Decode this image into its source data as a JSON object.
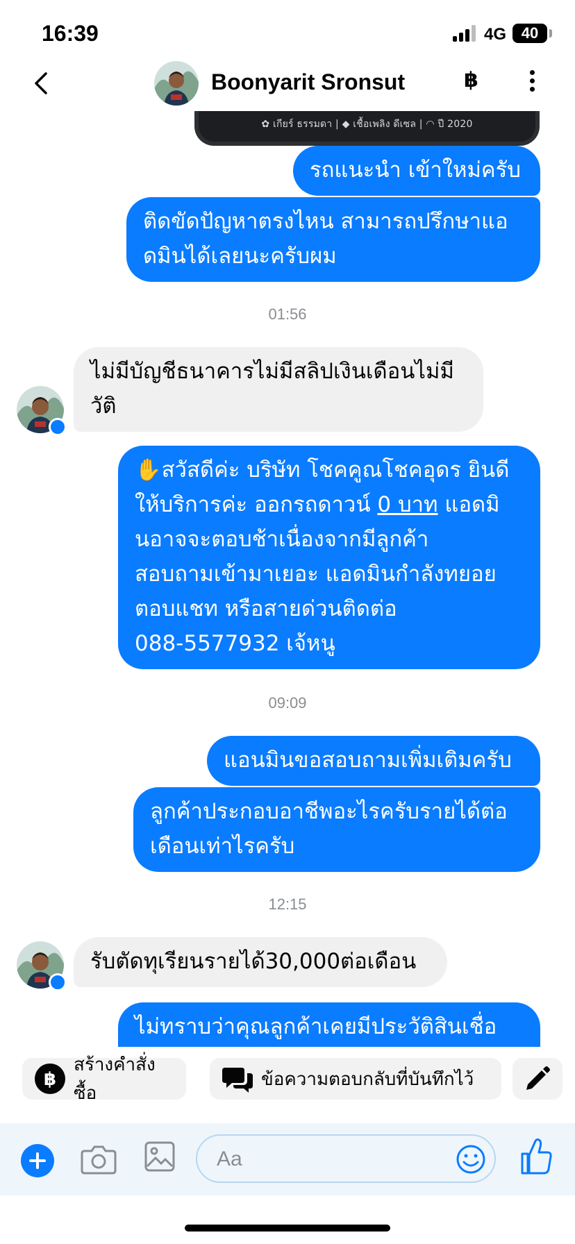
{
  "status_bar": {
    "time": "16:39",
    "network": "4G",
    "battery": "40"
  },
  "header": {
    "contact_name": "Boonyarit Sronsut",
    "baht_icon": "฿",
    "back_icon": "chevron-left-icon",
    "more_icon": "more-vertical-icon"
  },
  "card_caption": "✿ เกียร์ ธรรมดา   |  ◆ เชื้อเพลิง ดีเซล   |  ◠ ปี 2020",
  "messages": [
    {
      "from": "me",
      "text": "รถแนะนำ เข้าใหม่ครับ"
    },
    {
      "from": "me",
      "line1": "ติดขัดปัญหาตรงไหน สามารถปรึกษาแอ",
      "line2": "ดมินได้เลยนะครับผม"
    },
    {
      "timestamp": "01:56"
    },
    {
      "from": "them",
      "line1": "ไม่มีบัญชีธนาคารไม่มีสลิปเงินเดือนไม่มี",
      "line2": "วัติ"
    },
    {
      "from": "me",
      "emoji": "✋",
      "line1": "สวัสดีค่ะ บริษัท โชคคูณโชคอุดร ยินดี",
      "line2a": "ให้บริการค่ะ ออกรถดาวน์ ",
      "line2b": "0 บาท",
      "line2c": " แอดมิ",
      "line3": "นอาจจะตอบช้าเนื่องจากมีลูกค้า",
      "line4": "สอบถามเข้ามาเยอะ แอดมินกำลังทยอย",
      "line5": "ตอบแชท หรือสายด่วนติดต่อ",
      "line6": "088-5577932 เจ้หนู"
    },
    {
      "timestamp": "09:09"
    },
    {
      "from": "me",
      "text": "แอนมินขอสอบถามเพิ่มเติมครับ"
    },
    {
      "from": "me",
      "line1": "ลูกค้าประกอบอาชีพอะไรครับรายได้ต่อ",
      "line2": "เดือนเท่าไรครับ"
    },
    {
      "timestamp": "12:15"
    },
    {
      "from": "them",
      "text": "รับตัดทุเรียนรายได้30,000ต่อเดือน"
    },
    {
      "from": "me",
      "text": "ไม่ทราบว่าคุณลูกค้าเคยมีประวัติสินเชื่อ"
    }
  ],
  "quick_replies": {
    "create_order": "สร้างคำสั่งซื้อ",
    "saved_replies": "ข้อความตอบกลับที่บันทึกไว้"
  },
  "composer": {
    "placeholder": "Aa"
  },
  "colors": {
    "accent": "#0a7cff",
    "incoming_bubble": "#f0f0f0"
  }
}
